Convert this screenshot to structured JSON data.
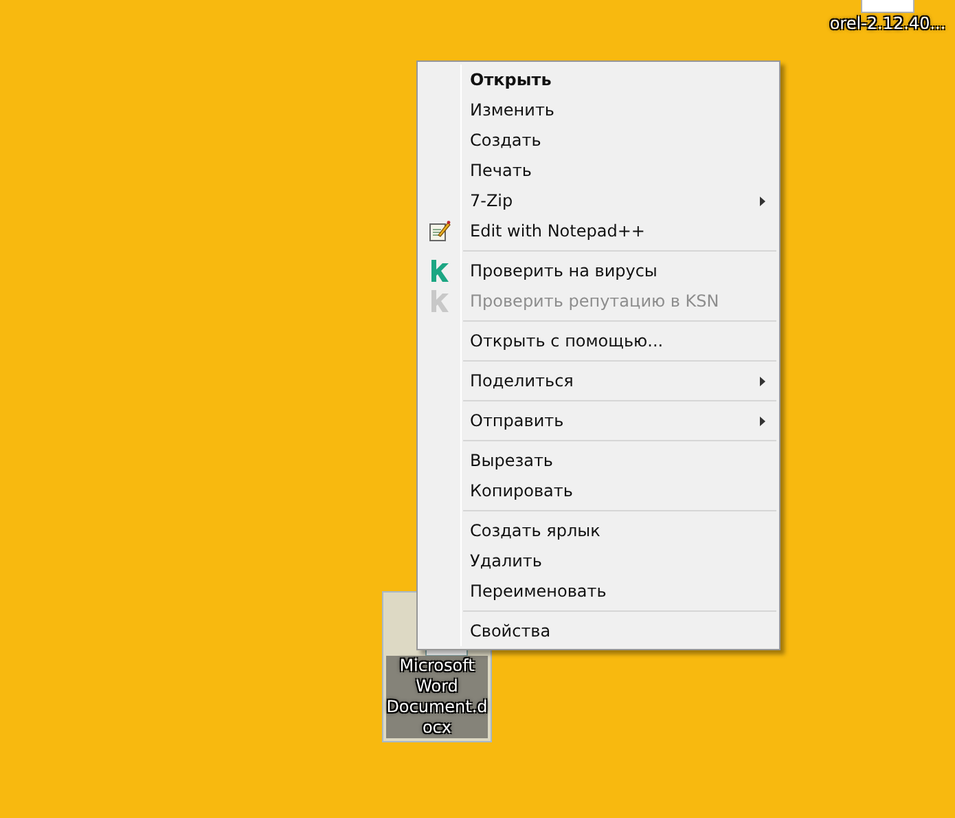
{
  "desktop_icons": [
    {
      "label_lines": [
        "orel-2.12.40..."
      ],
      "selected": false,
      "kind": "file"
    },
    {
      "label_lines": [
        "Microsoft",
        "Word",
        "Document.d",
        "ocx"
      ],
      "selected": true,
      "kind": "word"
    }
  ],
  "context_menu": [
    {
      "kind": "item",
      "label": "Открыть",
      "bold": true,
      "disabled": false,
      "submenu": false
    },
    {
      "kind": "item",
      "label": "Изменить",
      "bold": false,
      "disabled": false,
      "submenu": false
    },
    {
      "kind": "item",
      "label": "Создать",
      "bold": false,
      "disabled": false,
      "submenu": false
    },
    {
      "kind": "item",
      "label": "Печать",
      "bold": false,
      "disabled": false,
      "submenu": false
    },
    {
      "kind": "item",
      "label": "7-Zip",
      "bold": false,
      "disabled": false,
      "submenu": true
    },
    {
      "kind": "notepad",
      "label": "Edit with Notepad++",
      "bold": false,
      "disabled": false,
      "submenu": false
    },
    {
      "kind": "separator"
    },
    {
      "kind": "antivirus",
      "label": "Проверить на вирусы",
      "bold": false,
      "disabled": false,
      "submenu": false
    },
    {
      "kind": "antivirus",
      "label": "Проверить репутацию в KSN",
      "bold": false,
      "disabled": true,
      "submenu": false
    },
    {
      "kind": "separator"
    },
    {
      "kind": "item",
      "label": "Открыть с помощью...",
      "bold": false,
      "disabled": false,
      "submenu": false
    },
    {
      "kind": "separator"
    },
    {
      "kind": "item",
      "label": "Поделиться",
      "bold": false,
      "disabled": false,
      "submenu": true
    },
    {
      "kind": "separator"
    },
    {
      "kind": "item",
      "label": "Отправить",
      "bold": false,
      "disabled": false,
      "submenu": true
    },
    {
      "kind": "separator"
    },
    {
      "kind": "item",
      "label": "Вырезать",
      "bold": false,
      "disabled": false,
      "submenu": false
    },
    {
      "kind": "item",
      "label": "Копировать",
      "bold": false,
      "disabled": false,
      "submenu": false
    },
    {
      "kind": "separator"
    },
    {
      "kind": "item",
      "label": "Создать ярлык",
      "bold": false,
      "disabled": false,
      "submenu": false
    },
    {
      "kind": "item",
      "label": "Удалить",
      "bold": false,
      "disabled": false,
      "submenu": false
    },
    {
      "kind": "item",
      "label": "Переименовать",
      "bold": false,
      "disabled": false,
      "submenu": false
    },
    {
      "kind": "separator"
    },
    {
      "kind": "item",
      "label": "Свойства",
      "bold": false,
      "disabled": false,
      "submenu": false
    }
  ]
}
